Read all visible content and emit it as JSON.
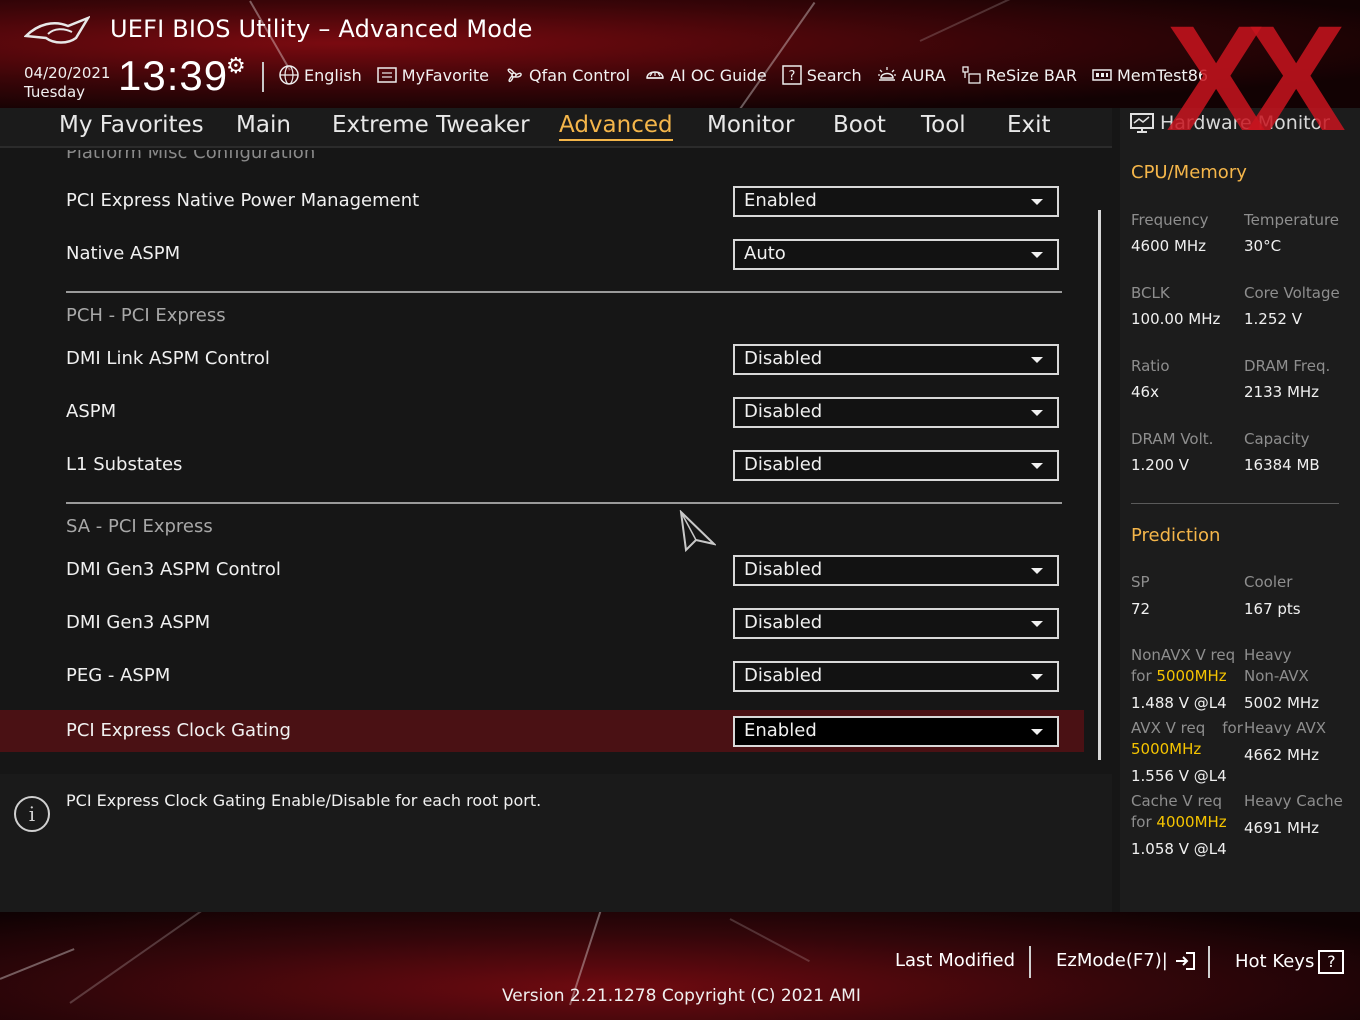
{
  "header": {
    "title": "UEFI BIOS Utility – Advanced Mode",
    "date": "04/20/2021",
    "day": "Tuesday",
    "time": "13:39",
    "tools": [
      {
        "label": "English",
        "icon": "globe-icon"
      },
      {
        "label": "MyFavorite",
        "icon": "favorite-list-icon"
      },
      {
        "label": "Qfan Control",
        "icon": "fan-icon"
      },
      {
        "label": "AI OC Guide",
        "icon": "ai-oc-icon"
      },
      {
        "label": "Search",
        "icon": "search-icon"
      },
      {
        "label": "AURA",
        "icon": "aura-icon"
      },
      {
        "label": "ReSize BAR",
        "icon": "resize-bar-icon"
      },
      {
        "label": "MemTest86",
        "icon": "memory-icon"
      }
    ]
  },
  "nav": {
    "tabs": [
      "My Favorites",
      "Main",
      "Extreme Tweaker",
      "Advanced",
      "Monitor",
      "Boot",
      "Tool",
      "Exit"
    ],
    "active": "Advanced"
  },
  "panel": {
    "cut_label": "Platform Misc Configuration",
    "rows": [
      {
        "label": "PCI Express Native Power Management",
        "value": "Enabled"
      },
      {
        "label": "Native ASPM",
        "value": "Auto"
      },
      {
        "label": "DMI Link ASPM Control",
        "value": "Disabled"
      },
      {
        "label": "ASPM",
        "value": "Disabled"
      },
      {
        "label": "L1 Substates",
        "value": "Disabled"
      },
      {
        "label": "DMI Gen3 ASPM Control",
        "value": "Disabled"
      },
      {
        "label": "DMI Gen3 ASPM",
        "value": "Disabled"
      },
      {
        "label": "PEG - ASPM",
        "value": "Disabled"
      },
      {
        "label": "PCI Express Clock Gating",
        "value": "Enabled"
      }
    ],
    "sections": [
      "PCH - PCI Express",
      "SA - PCI Express"
    ]
  },
  "help": {
    "text": "PCI Express Clock Gating Enable/Disable for each root port."
  },
  "hw_monitor": {
    "title": "Hardware Monitor",
    "cpu_section": "CPU/Memory",
    "cpu": [
      {
        "label": "Frequency",
        "value": "4600 MHz"
      },
      {
        "label": "Temperature",
        "value": "30°C"
      },
      {
        "label": "BCLK",
        "value": "100.00 MHz"
      },
      {
        "label": "Core Voltage",
        "value": "1.252 V"
      },
      {
        "label": "Ratio",
        "value": "46x"
      },
      {
        "label": "DRAM Freq.",
        "value": "2133 MHz"
      },
      {
        "label": "DRAM Volt.",
        "value": "1.200 V"
      },
      {
        "label": "Capacity",
        "value": "16384 MB"
      }
    ],
    "prediction_section": "Prediction",
    "sp_label": "SP",
    "sp_value": "72",
    "cooler_label": "Cooler",
    "cooler_value": "167 pts",
    "nonavx_label_1": "NonAVX V req",
    "nonavx_label_2": "for ",
    "nonavx_freq": "5000MHz",
    "nonavx_value": "1.488 V @L4",
    "heavy_nonavx_label_1": "Heavy",
    "heavy_nonavx_label_2": "Non-AVX",
    "heavy_nonavx_value": "5002 MHz",
    "avx_label_1": "AVX V req",
    "avx_label_for": "for",
    "avx_freq": "5000MHz",
    "avx_value": "1.556 V @L4",
    "heavy_avx_label": "Heavy AVX",
    "heavy_avx_value": "4662 MHz",
    "cache_label_1": "Cache V req",
    "cache_label_2": "for ",
    "cache_freq": "4000MHz",
    "cache_value": "1.058 V @L4",
    "heavy_cache_label": "Heavy Cache",
    "heavy_cache_value": "4691 MHz"
  },
  "footer": {
    "last_modified": "Last Modified",
    "ezmode": "EzMode(F7)|",
    "hotkeys": "Hot Keys",
    "hotkeys_key": "?",
    "version": "Version 2.21.1278 Copyright (C) 2021 AMI"
  },
  "watermark": "XX",
  "colors": {
    "accent": "#f5b64a",
    "highlight_row": "#4a1114",
    "prediction_highlight": "#f5c400",
    "brand_red": "#7a0a10"
  }
}
